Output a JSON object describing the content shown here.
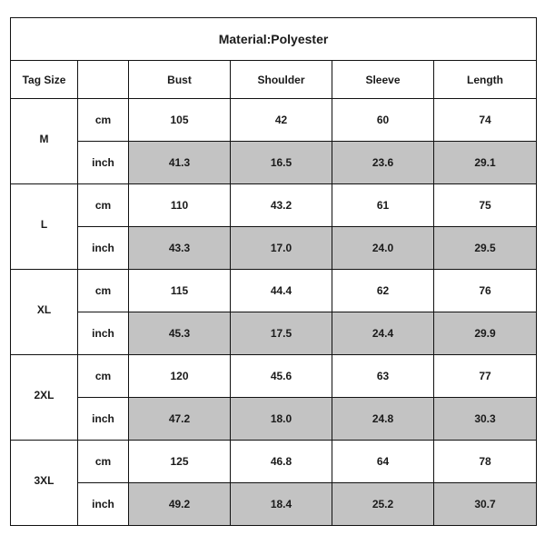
{
  "title": "Material:Polyester",
  "headers": [
    "Tag Size",
    "",
    "Bust",
    "Shoulder",
    "Sleeve",
    "Length"
  ],
  "shade_color": "#c3c3c3",
  "sizes": [
    {
      "tag": "M",
      "cm": [
        "105",
        "42",
        "60",
        "74"
      ],
      "inch": [
        "41.3",
        "16.5",
        "23.6",
        "29.1"
      ]
    },
    {
      "tag": "L",
      "cm": [
        "110",
        "43.2",
        "61",
        "75"
      ],
      "inch": [
        "43.3",
        "17.0",
        "24.0",
        "29.5"
      ]
    },
    {
      "tag": "XL",
      "cm": [
        "115",
        "44.4",
        "62",
        "76"
      ],
      "inch": [
        "45.3",
        "17.5",
        "24.4",
        "29.9"
      ]
    },
    {
      "tag": "2XL",
      "cm": [
        "120",
        "45.6",
        "63",
        "77"
      ],
      "inch": [
        "47.2",
        "18.0",
        "24.8",
        "30.3"
      ]
    },
    {
      "tag": "3XL",
      "cm": [
        "125",
        "46.8",
        "64",
        "78"
      ],
      "inch": [
        "49.2",
        "18.4",
        "25.2",
        "30.7"
      ]
    }
  ],
  "units": {
    "cm": "cm",
    "inch": "inch"
  }
}
